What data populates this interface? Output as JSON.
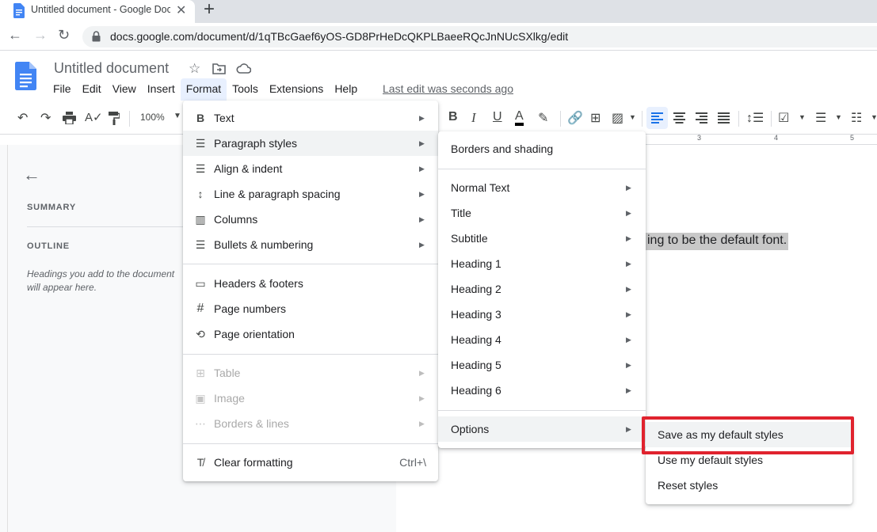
{
  "browser": {
    "tab_title": "Untitled document - Google Doc",
    "tab_close": "✕",
    "new_tab": "+",
    "url": "docs.google.com/document/d/1qTBcGaef6yOS-GD8PrHeDcQKPLBaeeRQcJnNUcSXlkg/edit"
  },
  "doc": {
    "title": "Untitled document",
    "last_edit": "Last edit was seconds ago",
    "body_text": "ing to be the default font."
  },
  "menubar": [
    "File",
    "Edit",
    "View",
    "Insert",
    "Format",
    "Tools",
    "Extensions",
    "Help"
  ],
  "toolbar": {
    "zoom": "100%",
    "bold": "B",
    "italic": "I",
    "underline": "U",
    "text_color": "A"
  },
  "ruler": [
    "3",
    "4",
    "5"
  ],
  "outline_panel": {
    "summary_label": "SUMMARY",
    "outline_label": "OUTLINE",
    "hint": "Headings you add to the document will appear here."
  },
  "format_menu": {
    "items": [
      {
        "label": "Text",
        "icon": "B"
      },
      {
        "label": "Paragraph styles",
        "icon": "☰"
      },
      {
        "label": "Align & indent",
        "icon": "☰"
      },
      {
        "label": "Line & paragraph spacing",
        "icon": "↕"
      },
      {
        "label": "Columns",
        "icon": "▥"
      },
      {
        "label": "Bullets & numbering",
        "icon": "☰"
      },
      {
        "label": "Headers & footers",
        "icon": "▭"
      },
      {
        "label": "Page numbers",
        "icon": "#"
      },
      {
        "label": "Page orientation",
        "icon": "⟲"
      },
      {
        "label": "Table",
        "icon": "⊞"
      },
      {
        "label": "Image",
        "icon": "▣"
      },
      {
        "label": "Borders & lines",
        "icon": "⋯"
      },
      {
        "label": "Clear formatting",
        "icon": "T̸",
        "shortcut": "Ctrl+\\"
      }
    ]
  },
  "paragraph_styles_menu": {
    "items": [
      "Borders and shading",
      "Normal Text",
      "Title",
      "Subtitle",
      "Heading 1",
      "Heading 2",
      "Heading 3",
      "Heading 4",
      "Heading 5",
      "Heading 6",
      "Options"
    ]
  },
  "options_menu": {
    "items": [
      "Save as my default styles",
      "Use my default styles",
      "Reset styles"
    ]
  },
  "colors": {
    "accent_blue": "#1a73e8",
    "highlight_red": "#e0232e",
    "menu_hover": "#f1f3f4"
  }
}
